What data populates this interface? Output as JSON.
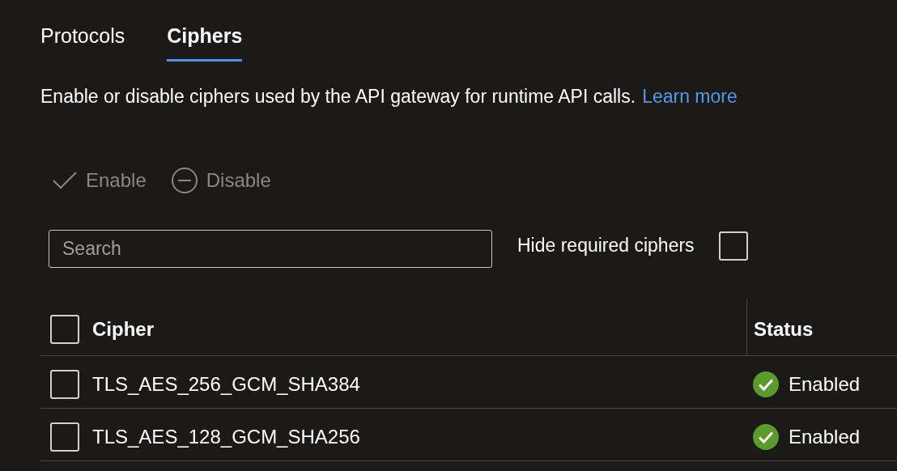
{
  "tabs": [
    {
      "label": "Protocols",
      "selected": false
    },
    {
      "label": "Ciphers",
      "selected": true
    }
  ],
  "description": {
    "text": "Enable or disable ciphers used by the API gateway for runtime API calls.",
    "link": "Learn more"
  },
  "toolbar": [
    {
      "kind": "enable",
      "label": "Enable",
      "disabled": true
    },
    {
      "kind": "disable",
      "label": "Disable",
      "disabled": true
    }
  ],
  "search": {
    "placeholder": "Search"
  },
  "hide_required": {
    "label": "Hide required ciphers",
    "checked": false
  },
  "table": {
    "select_all_checked": false,
    "columns": [
      "Cipher",
      "Status"
    ],
    "rows": [
      {
        "cipher": "TLS_AES_256_GCM_SHA384",
        "status": "Enabled",
        "enabled": true,
        "checked": false
      },
      {
        "cipher": "TLS_AES_128_GCM_SHA256",
        "status": "Enabled",
        "enabled": true,
        "checked": false
      }
    ]
  }
}
